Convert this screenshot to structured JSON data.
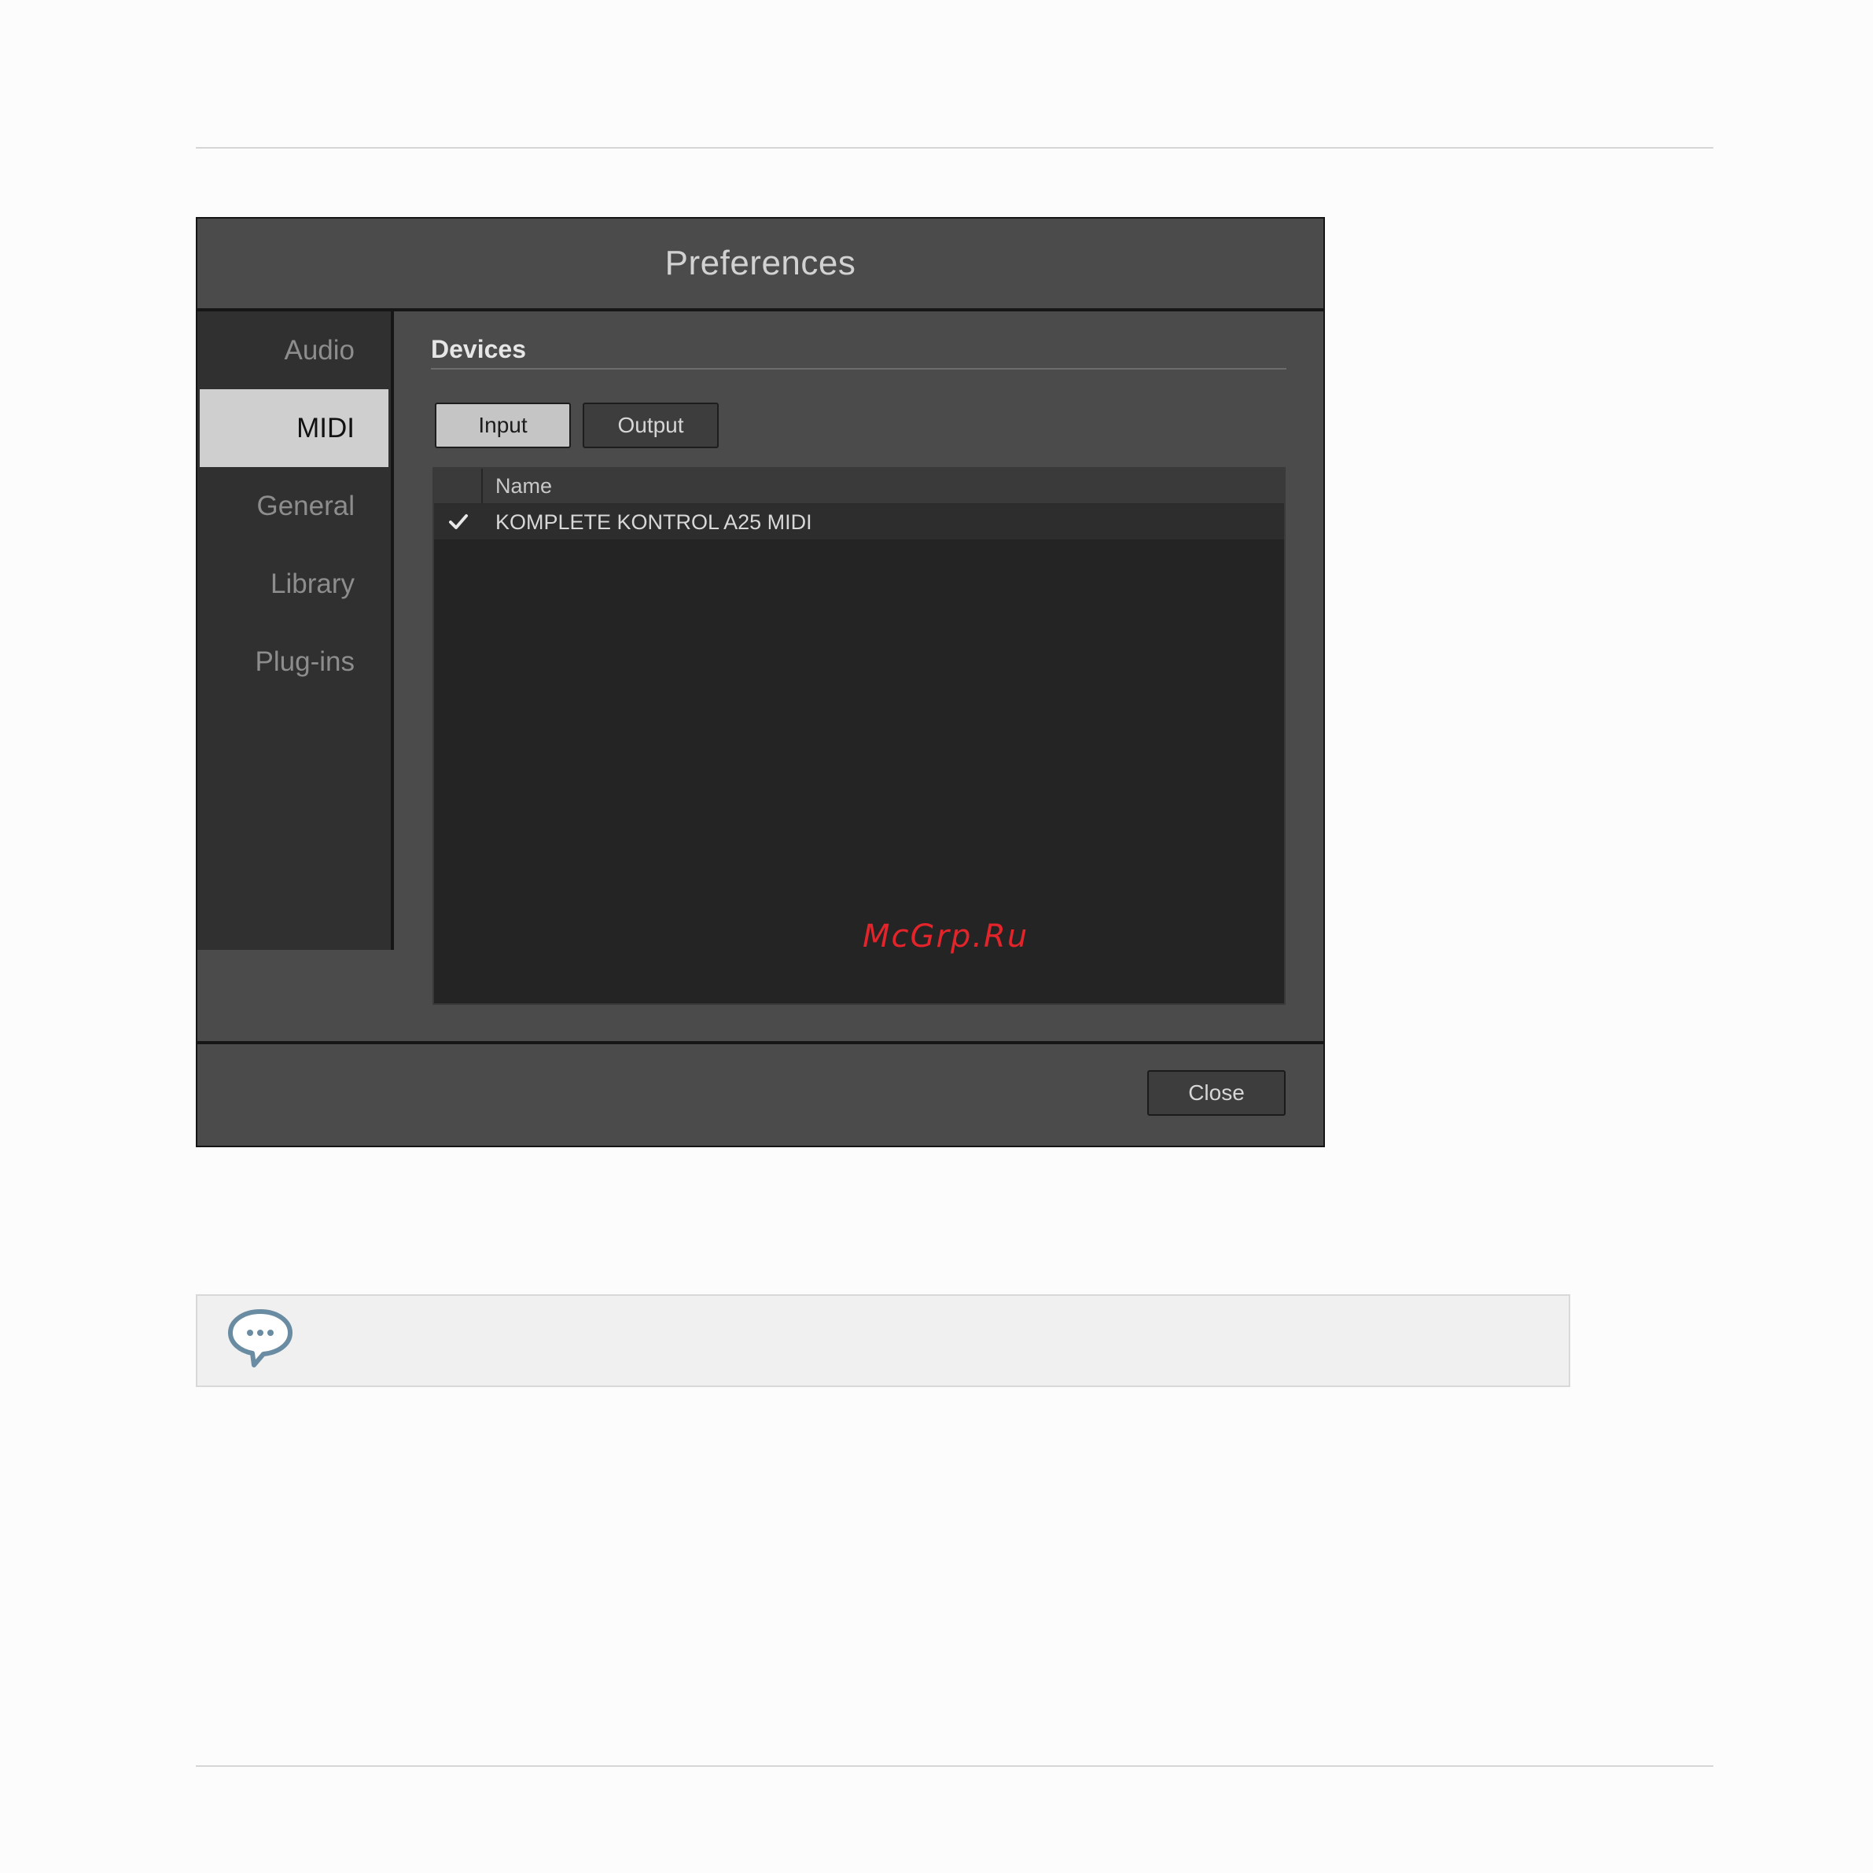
{
  "dialog": {
    "title": "Preferences",
    "sidebar": {
      "items": [
        {
          "label": "Audio",
          "active": false
        },
        {
          "label": "MIDI",
          "active": true
        },
        {
          "label": "General",
          "active": false
        },
        {
          "label": "Library",
          "active": false
        },
        {
          "label": "Plug-ins",
          "active": false
        }
      ]
    },
    "devices": {
      "section_title": "Devices",
      "tabs": {
        "input_label": "Input",
        "output_label": "Output",
        "selected": "Input"
      },
      "table": {
        "column_header": "Name",
        "rows": [
          {
            "checked": true,
            "name": "KOMPLETE KONTROL A25 MIDI"
          }
        ]
      }
    },
    "footer": {
      "close_label": "Close"
    }
  },
  "watermark": "McGrp.Ru",
  "note": {
    "icon": "speech-bubble-icon"
  },
  "colors": {
    "dialog_bg": "#4b4b4b",
    "sidebar_bg": "#303030",
    "active_item_bg": "#cfcfcf",
    "table_bg": "#242424",
    "watermark": "#e3242b",
    "note_icon": "#6a8ca3"
  }
}
